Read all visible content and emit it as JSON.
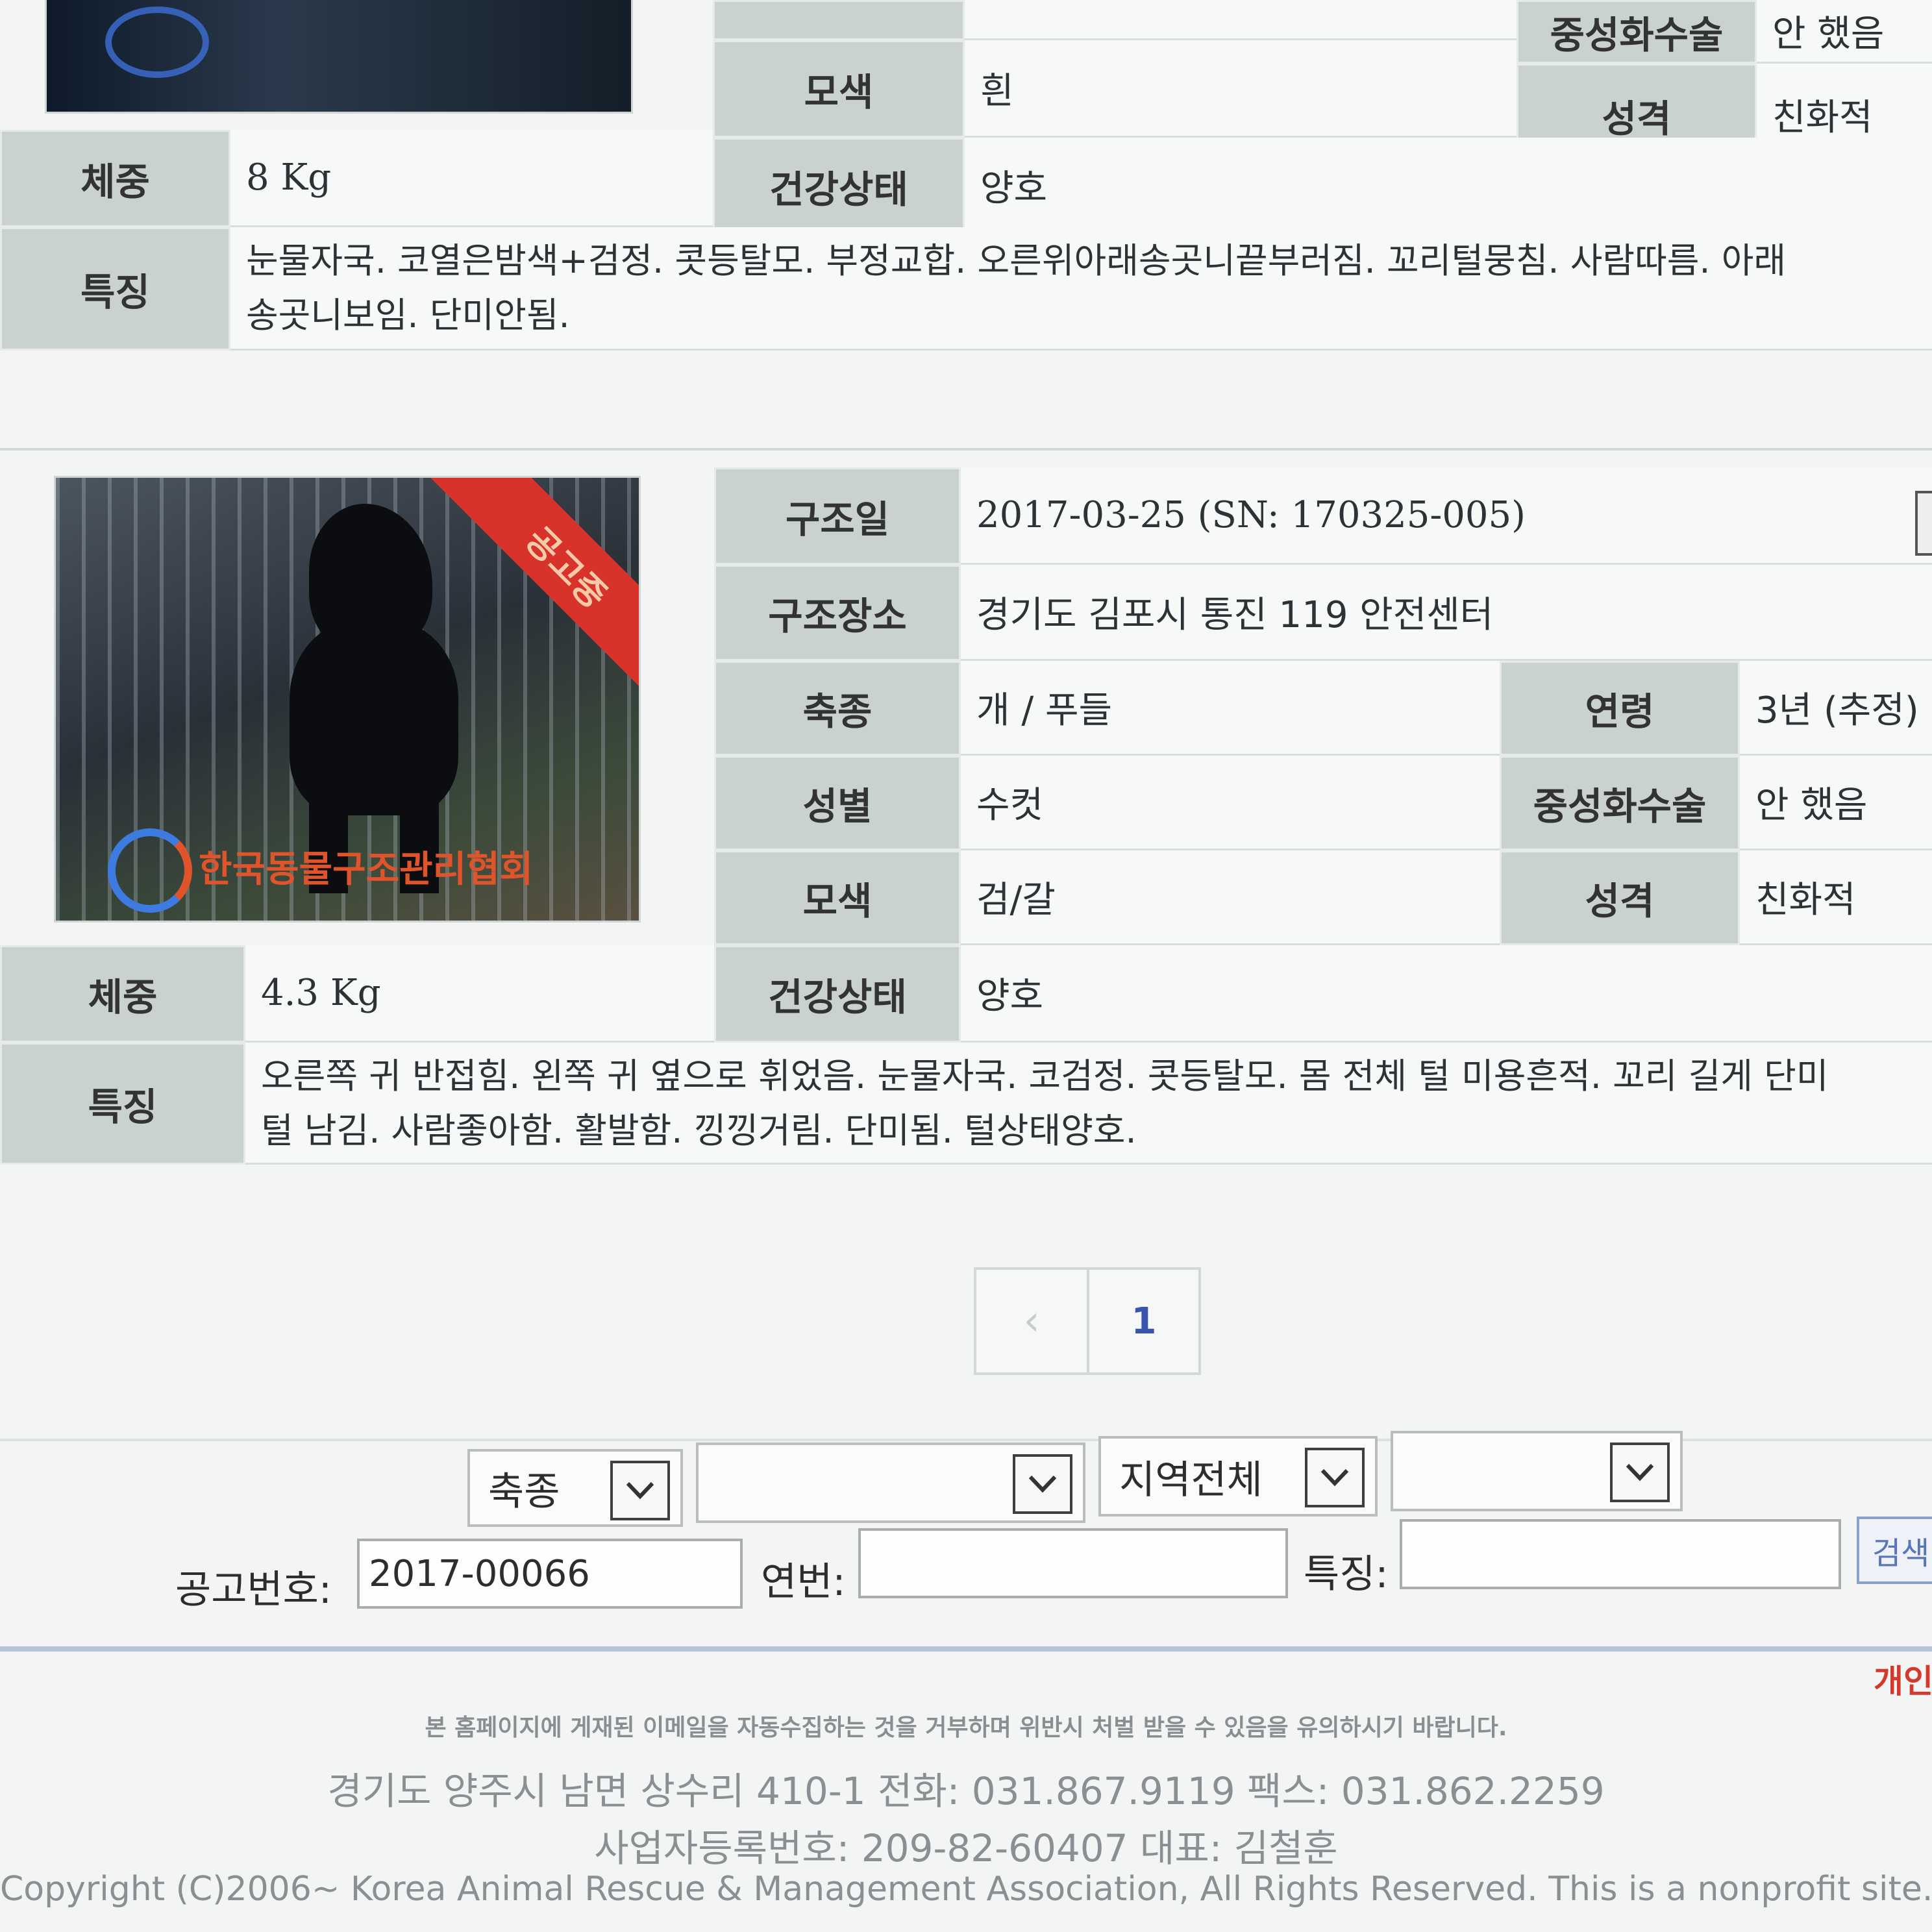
{
  "prev_record": {
    "rows": [
      {
        "label": "중성화수술",
        "value": "안 했음"
      },
      {
        "label": "모색",
        "value": "흰"
      },
      {
        "label": "성격",
        "value": "친화적"
      },
      {
        "label": "체중",
        "value": "8 Kg"
      },
      {
        "label": "건강상태",
        "value": "양호"
      }
    ],
    "feature_label": "특징",
    "feature_line1": "눈물자국. 코열은밤색+검정. 콧등탈모. 부정교합. 오른위아래송곳니끝부러짐. 꼬리털뭉침. 사람따름. 아래",
    "feature_line2": "송곳니보임. 단미안됨."
  },
  "record": {
    "ribbon": "공고중",
    "watermark": "한국동물구조관리협회",
    "rows": {
      "rescue_date": {
        "label": "구조일",
        "value": "2017-03-25  (SN: 170325-005)"
      },
      "rescue_place": {
        "label": "구조장소",
        "value": "경기도 김포시 통진 119 안전센터"
      },
      "species": {
        "label": "축종",
        "value": "개 / 푸들"
      },
      "age": {
        "label": "연령",
        "value": "3년 (추정)"
      },
      "sex": {
        "label": "성별",
        "value": "수컷"
      },
      "neuter": {
        "label": "중성화수술",
        "value": "안 했음"
      },
      "color": {
        "label": "모색",
        "value": "검/갈"
      },
      "personality": {
        "label": "성격",
        "value": "친화적"
      },
      "weight": {
        "label": "체중",
        "value": "4.3 Kg"
      },
      "health": {
        "label": "건강상태",
        "value": "양호"
      }
    },
    "feature_label": "특징",
    "feature_line1": "오른쪽 귀 반접힘. 왼쪽 귀 옆으로 휘었음. 눈물자국. 코검정. 콧등탈모. 몸 전체 털 미용흔적. 꼬리 길게 단미",
    "feature_line2": "털 남김. 사람좋아함. 활발함. 낑낑거림. 단미됨. 털상태양호."
  },
  "pagination": {
    "prev": "‹",
    "page": "1"
  },
  "search": {
    "species_select": "축종",
    "breed_select": "",
    "region_select": "지역전체",
    "subregion_select": "",
    "notice_label": "공고번호:",
    "notice_value": "2017-00066",
    "serial_label": "연번:",
    "serial_value": "",
    "feature_label": "특징:",
    "feature_value": "",
    "search_button": "검색"
  },
  "footer": {
    "privacy_link": "개인",
    "notice": "본 홈페이지에 게재된 이메일을 자동수집하는 것을 거부하며 위반시 처벌 받을 수 있음을 유의하시기 바랍니다.",
    "address": "경기도 양주시 남면 상수리 410-1 전화: 031.867.9119 팩스: 031.862.2259",
    "biz": "사업자등록번호: 209-82-60407 대표: 김철훈",
    "copyright": "Copyright (C)2006~ Korea Animal Rescue & Management Association, All Rights Reserved. This is a nonprofit site."
  },
  "colors": {
    "label_bg": "#c9d2cf",
    "ribbon": "#d7332a",
    "page_link": "#3a55b0",
    "privacy": "#d33a2e"
  }
}
